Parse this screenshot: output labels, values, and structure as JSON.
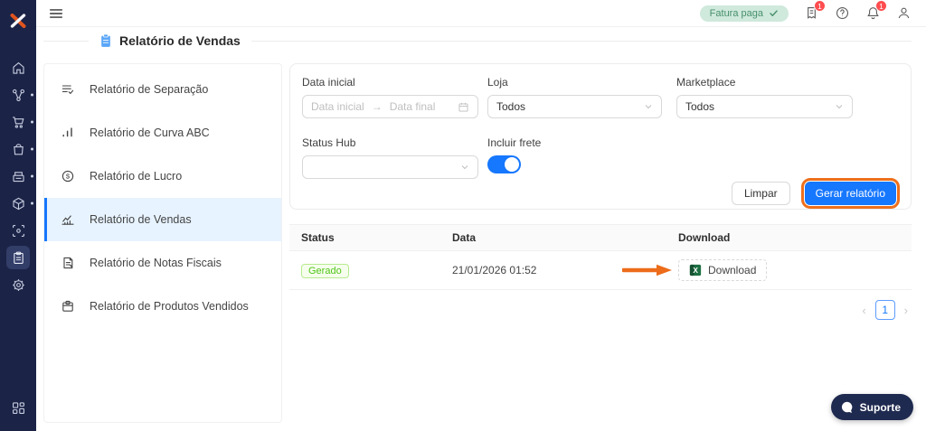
{
  "app": {
    "logo_text": "X",
    "support_label": "Suporte"
  },
  "topbar": {
    "invoice_status_badge": "Fatura paga",
    "invoice_notification_count": "1",
    "bell_notification_count": "1",
    "icons": [
      "hamburger-icon",
      "check-icon",
      "invoice-sync-icon",
      "help-icon",
      "bell-icon",
      "user-icon"
    ]
  },
  "page": {
    "title": "Relatório de Vendas",
    "title_icon": "clipboard-icon"
  },
  "nav_rail": {
    "icons": [
      "home-icon",
      "integrations-icon",
      "cart-icon",
      "bag-icon",
      "printer-icon",
      "package-icon",
      "scan-icon",
      "reports-icon",
      "gear-icon",
      "apps-icon"
    ],
    "active_icon": "reports-icon"
  },
  "sidebar": {
    "items": [
      {
        "label": "Relatório de Separação",
        "icon": "list-check-icon",
        "active": false
      },
      {
        "label": "Relatório de Curva ABC",
        "icon": "bar-chart-icon",
        "active": false
      },
      {
        "label": "Relatório de Lucro",
        "icon": "dollar-circle-icon",
        "active": false
      },
      {
        "label": "Relatório de Vendas",
        "icon": "line-chart-icon",
        "active": true
      },
      {
        "label": "Relatório de Notas Fiscais",
        "icon": "invoice-icon",
        "active": false
      },
      {
        "label": "Relatório de Produtos Vendidos",
        "icon": "product-box-icon",
        "active": false
      }
    ]
  },
  "filters": {
    "date_range": {
      "label": "Data inicial",
      "start_placeholder": "Data inicial",
      "separator": "→",
      "end_placeholder": "Data final"
    },
    "store": {
      "label": "Loja",
      "value": "Todos"
    },
    "marketplace": {
      "label": "Marketplace",
      "value": "Todos"
    },
    "status_hub": {
      "label": "Status Hub",
      "value": ""
    },
    "include_shipping": {
      "label": "Incluir frete",
      "enabled": true
    },
    "clear_button": "Limpar",
    "generate_button": "Gerar relatório"
  },
  "report_table": {
    "columns": [
      "Status",
      "Data",
      "Download"
    ],
    "rows": [
      {
        "status": "Gerado",
        "date": "21/01/2026 01:52",
        "download_label": "Download"
      }
    ]
  },
  "pagination": {
    "prev": "‹",
    "current_page": "1",
    "next": "›"
  },
  "colors": {
    "primary_blue": "#1677ff",
    "annotation_orange": "#ee6f1d",
    "rail_navy": "#1b2347",
    "active_menu_bg": "#e7f3ff",
    "success_text": "#52c41a",
    "success_bg": "#f6ffed",
    "success_border": "#b7eb8f",
    "fatura_pill_bg": "#cfe9dc",
    "fatura_pill_text": "#48906c",
    "notification_red": "#ff4d4f",
    "excel_green": "#1d6f42"
  }
}
